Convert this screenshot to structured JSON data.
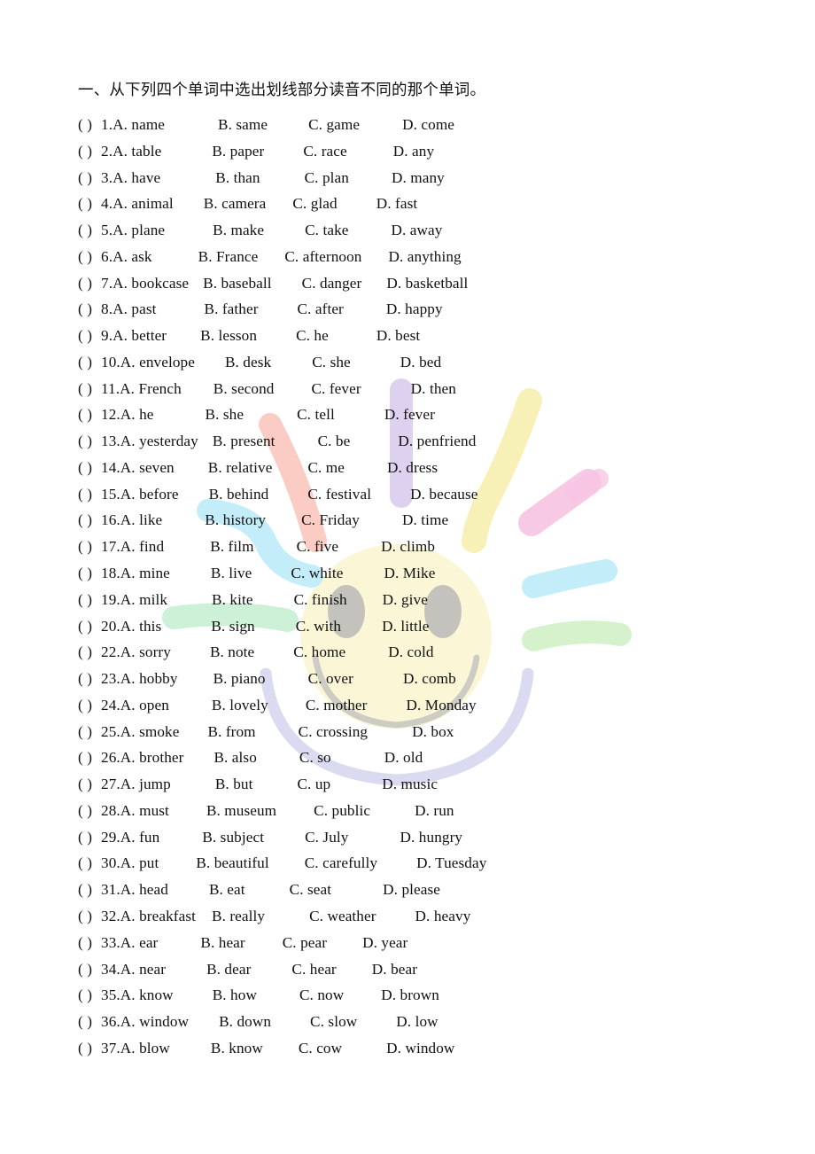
{
  "document": {
    "heading": "一、从下列四个单词中选出划线部分读音不同的那个单词。",
    "bracket": "(    )"
  },
  "colors": {
    "text": "#111111",
    "page_background": "#ffffff",
    "highlight_yellow": "#f7f0b4",
    "highlight_pink": "#f7c6e4",
    "highlight_salmon": "#fbc9c1",
    "highlight_lavender": "#dccdee",
    "highlight_cyan": "#bfecf9",
    "highlight_green": "#d3f1c9",
    "highlight_mint": "#c9f0d5",
    "watermark_gray": "#b9b9b9",
    "watermark_face": "#f9f5cf",
    "watermark_arc": "#d8d8ef"
  },
  "questions": [
    {
      "num": "1.",
      "sep": " ",
      "a": "A. name",
      "b": "B. same",
      "c": "C. game",
      "d": "D. come",
      "g1": 60,
      "g2": 46,
      "g3": 48
    },
    {
      "num": "2.",
      "sep": " ",
      "a": "A. table",
      "b": "B. paper",
      "c": "C. race",
      "d": "D. any",
      "g1": 57,
      "g2": 44,
      "g3": 52
    },
    {
      "num": "3.",
      "sep": " ",
      "a": "A. have",
      "b": "B. than",
      "c": "C. plan",
      "d": "D. many",
      "g1": 62,
      "g2": 50,
      "g3": 48
    },
    {
      "num": "4.",
      "sep": " ",
      "a": "A. animal",
      "b": "B. camera",
      "c": "C. glad",
      "d": "D. fast",
      "g1": 34,
      "g2": 30,
      "g3": 44
    },
    {
      "num": "5.",
      "sep": " ",
      "a": "A. plane",
      "b": "B. make",
      "c": "C. take",
      "d": "D. away",
      "g1": 54,
      "g2": 46,
      "g3": 48
    },
    {
      "num": "6.",
      "sep": " ",
      "a": "A. ask",
      "b": "B. France",
      "c": "C. afternoon",
      "d": "D. anything",
      "g1": 52,
      "g2": 30,
      "g3": 30
    },
    {
      "num": "7.",
      "sep": " ",
      "a": "A. bookcase",
      "b": "B. baseball",
      "c": "C. danger",
      "d": "D. basketball",
      "g1": 16,
      "g2": 34,
      "g3": 28
    },
    {
      "num": "8.",
      "sep": " ",
      "a": "A. past",
      "b": "B. father",
      "c": "C. after",
      "d": "D. happy",
      "g1": 54,
      "g2": 44,
      "g3": 48
    },
    {
      "num": "9.",
      "sep": " ",
      "a": "A. better",
      "b": "B. lesson",
      "c": "C. he",
      "d": "D. best",
      "g1": 38,
      "g2": 44,
      "g3": 54
    },
    {
      "num": "10.",
      "sep": "",
      "a": "A. envelope",
      "b": "B. desk",
      "c": "C. she",
      "d": "D. bed",
      "g1": 34,
      "g2": 46,
      "g3": 56
    },
    {
      "num": "11.",
      "sep": "",
      "a": "A. French",
      "b": "B. second",
      "c": "C. fever",
      "d": "D. then",
      "g1": 36,
      "g2": 42,
      "g3": 56
    },
    {
      "num": "12.",
      "sep": "",
      "a": "A. he",
      "b": "B. she",
      "c": "C. tell",
      "d": "D. fever",
      "g1": 58,
      "g2": 60,
      "g3": 56
    },
    {
      "num": "13.",
      "sep": "",
      "a": "A. yesterday",
      "b": "B. present",
      "c": "C. be",
      "d": "D. penfriend",
      "g1": 16,
      "g2": 48,
      "g3": 54
    },
    {
      "num": "14.",
      "sep": "",
      "a": "A. seven",
      "b": "B. relative",
      "c": "C. me",
      "d": "D. dress",
      "g1": 38,
      "g2": 40,
      "g3": 48
    },
    {
      "num": "15.",
      "sep": "",
      "a": "A. before",
      "b": "B. behind",
      "c": "C. festival",
      "d": "D. because",
      "g1": 34,
      "g2": 44,
      "g3": 44
    },
    {
      "num": "16.",
      "sep": "",
      "a": "A. like",
      "b": "B. history",
      "c": "C. Friday",
      "d": "D. time",
      "g1": 48,
      "g2": 40,
      "g3": 48
    },
    {
      "num": "17.",
      "sep": "",
      "a": "A. find",
      "b": "B. film",
      "c": "C. five",
      "d": "D. climb",
      "g1": 52,
      "g2": 48,
      "g3": 48
    },
    {
      "num": "18.",
      "sep": "",
      "a": "A. mine",
      "b": "B. live",
      "c": "C. white",
      "d": "D. Mike",
      "g1": 46,
      "g2": 44,
      "g3": 46
    },
    {
      "num": "19.",
      "sep": "",
      "a": "A. milk",
      "b": "B. kite",
      "c": "C. finish",
      "d": "D. give",
      "g1": 50,
      "g2": 46,
      "g3": 40
    },
    {
      "num": "20.",
      "sep": "",
      "a": "A. this",
      "b": "B. sign",
      "c": "C. with",
      "d": "D. little",
      "g1": 56,
      "g2": 46,
      "g3": 46
    },
    {
      "num": "22.",
      "sep": "",
      "a": "A. sorry",
      "b": "B. note",
      "c": "C. home",
      "d": "D. cold",
      "g1": 44,
      "g2": 44,
      "g3": 48
    },
    {
      "num": "23.",
      "sep": "",
      "a": "A. hobby",
      "b": "B. piano",
      "c": "C. over",
      "d": "D. comb",
      "g1": 40,
      "g2": 48,
      "g3": 56
    },
    {
      "num": "24.",
      "sep": "",
      "a": "A. open",
      "b": "B. lovely",
      "c": "C. mother",
      "d": "D. Monday",
      "g1": 48,
      "g2": 42,
      "g3": 44
    },
    {
      "num": "25.",
      "sep": "",
      "a": "A. smoke",
      "b": "B. from",
      "c": "C. crossing",
      "d": "D. box",
      "g1": 32,
      "g2": 48,
      "g3": 50
    },
    {
      "num": "26.",
      "sep": "",
      "a": "A. brother",
      "b": "B. also",
      "c": "C. so",
      "d": "D. old",
      "g1": 34,
      "g2": 48,
      "g3": 60
    },
    {
      "num": "27.",
      "sep": "",
      "a": "A. jump",
      "b": "B. but",
      "c": "C. up",
      "d": "D. music",
      "g1": 50,
      "g2": 50,
      "g3": 58
    },
    {
      "num": "28.",
      "sep": "",
      "a": "A. must",
      "b": "B. museum",
      "c": "C. public",
      "d": "D. run",
      "g1": 42,
      "g2": 42,
      "g3": 50
    },
    {
      "num": "29.",
      "sep": "",
      "a": "A. fun",
      "b": "B. subject",
      "c": "C. July",
      "d": "D. hungry",
      "g1": 48,
      "g2": 46,
      "g3": 58
    },
    {
      "num": "30.",
      "sep": "",
      "a": "A. put",
      "b": "B. beautiful",
      "c": "C. carefully",
      "d": "D. Tuesday",
      "g1": 42,
      "g2": 40,
      "g3": 44
    },
    {
      "num": "31.",
      "sep": "",
      "a": "A. head",
      "b": "B. eat",
      "c": "C. seat",
      "d": "D. please",
      "g1": 46,
      "g2": 50,
      "g3": 58
    },
    {
      "num": "32.",
      "sep": "",
      "a": "A. breakfast",
      "b": "B. really",
      "c": "C. weather",
      "d": "D. heavy",
      "g1": 18,
      "g2": 50,
      "g3": 44
    },
    {
      "num": "33.",
      "sep": "",
      "a": "A. ear",
      "b": "B. hear",
      "c": "C. pear",
      "d": "D. year",
      "g1": 48,
      "g2": 42,
      "g3": 40
    },
    {
      "num": "34.",
      "sep": "",
      "a": "A. near",
      "b": "B. dear",
      "c": "C. hear",
      "d": "D. bear",
      "g1": 46,
      "g2": 46,
      "g3": 40
    },
    {
      "num": "35.",
      "sep": "",
      "a": "A. know",
      "b": "B. how",
      "c": "C. now",
      "d": "D. brown",
      "g1": 44,
      "g2": 48,
      "g3": 42
    },
    {
      "num": "36.",
      "sep": "",
      "a": "A. window",
      "b": "B. down",
      "c": "C. slow",
      "d": "D. low",
      "g1": 34,
      "g2": 44,
      "g3": 44
    },
    {
      "num": "37.",
      "sep": "",
      "a": "A. blow",
      "b": "B. know",
      "c": "C. cow",
      "d": "D. window",
      "g1": 46,
      "g2": 40,
      "g3": 50
    }
  ]
}
